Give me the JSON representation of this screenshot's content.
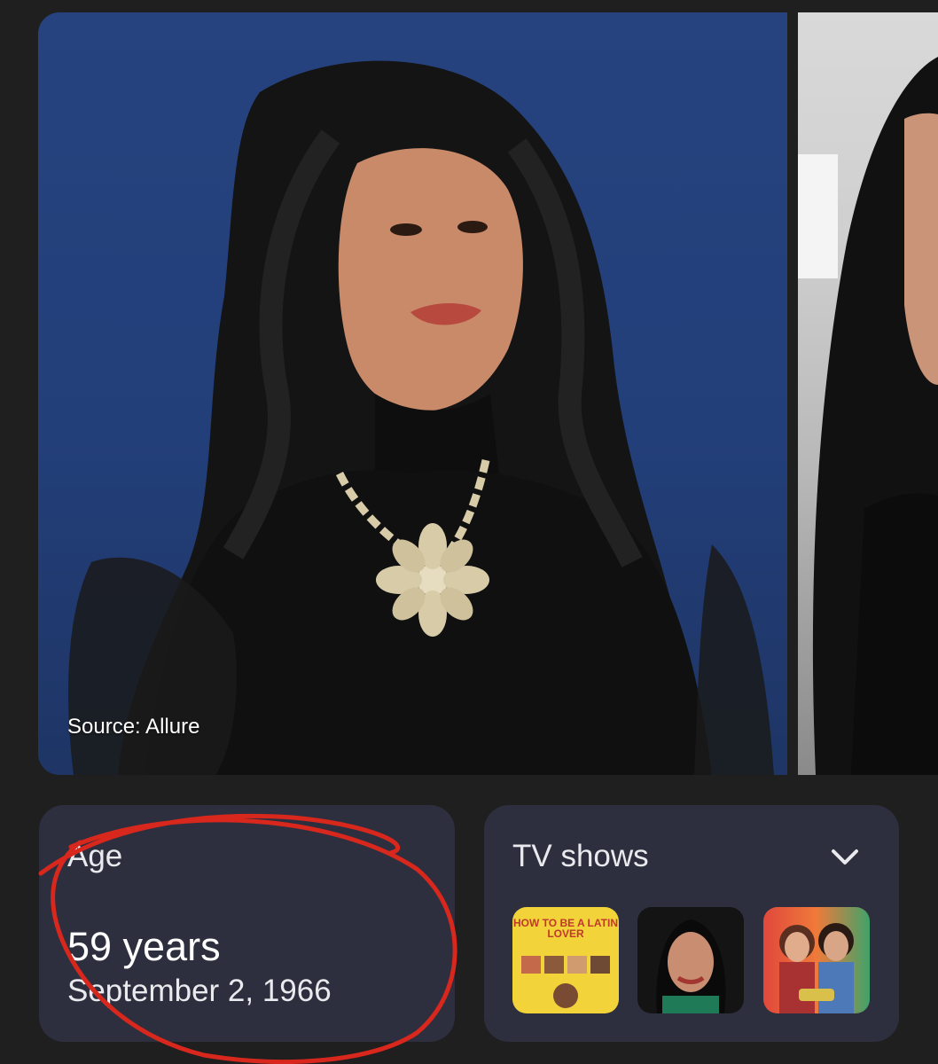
{
  "carousel": {
    "main_image_alt": "Portrait of woman with dark wavy hair and a jeweled necklace on blue backdrop",
    "source_caption": "Source: Allure"
  },
  "age_card": {
    "label": "Age",
    "value": "59 years",
    "birth_date": "September 2, 1966"
  },
  "tv_card": {
    "title": "TV shows",
    "expand_icon": "chevron-down-icon",
    "thumbnails": [
      {
        "title_text": "HOW TO BE A LATIN LOVER"
      },
      {
        "title_text": ""
      },
      {
        "title_text": ""
      }
    ]
  },
  "annotation": {
    "color": "#d8271c"
  }
}
